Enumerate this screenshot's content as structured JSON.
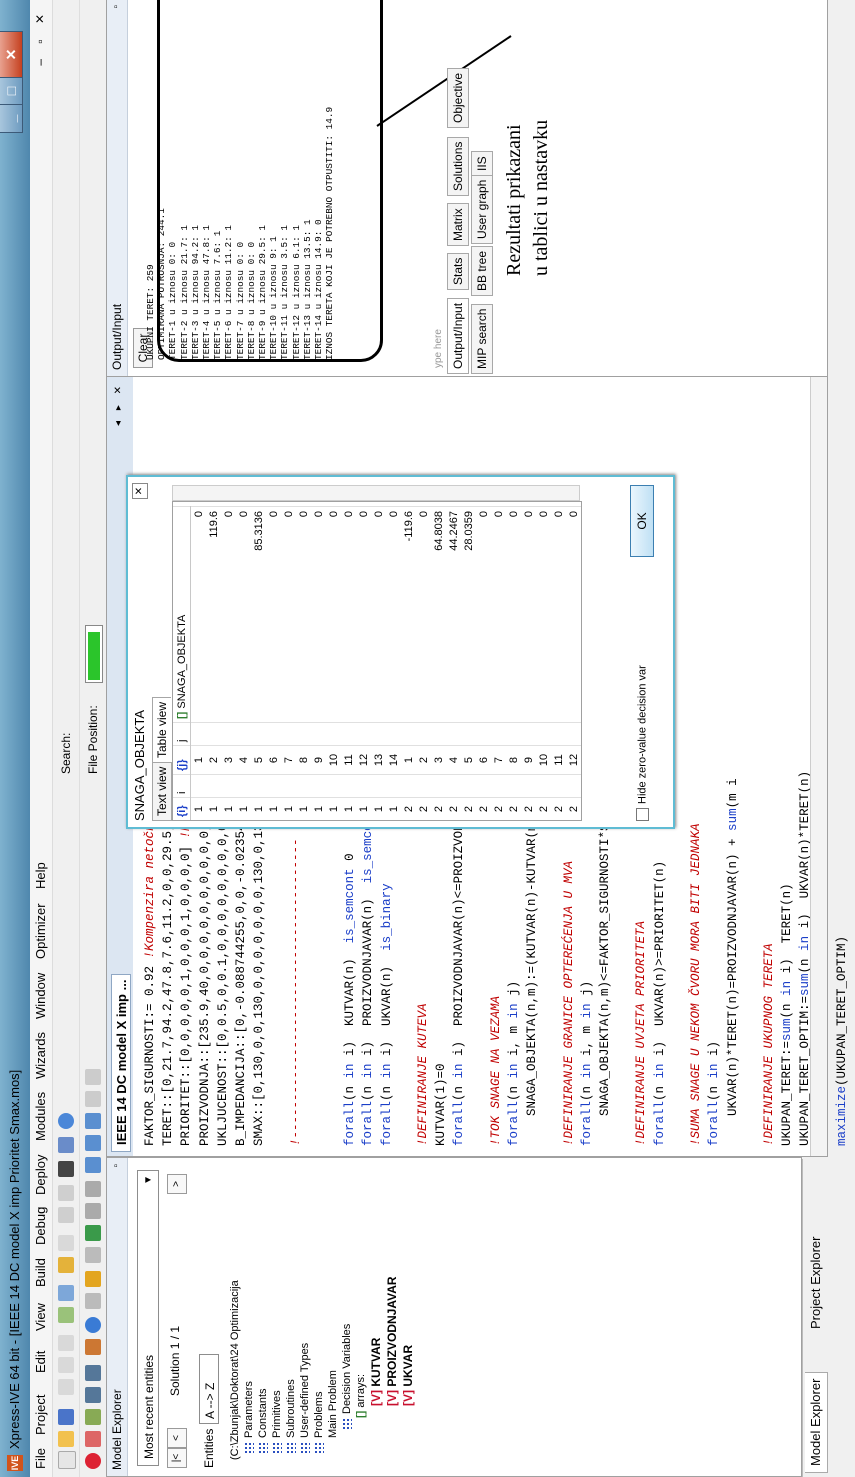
{
  "window": {
    "title": "Xpress-IVE 64 bit - [IEEE 14 DC model X imp Prioritet Smax.mos]",
    "app_icon": "IVE"
  },
  "menu": [
    "File",
    "Project",
    "Edit",
    "View",
    "Build",
    "Debug",
    "Deploy",
    "Modules",
    "Wizards",
    "Window",
    "Optimizer",
    "Help"
  ],
  "toolbar": {
    "search_label": "Search:",
    "file_position_label": "File Position:",
    "file_position_level": 0.92
  },
  "model_explorer": {
    "title": "Model Explorer",
    "recent": "Most recent entities",
    "solution": "Solution 1 / 1",
    "entities_label": "Entities",
    "sort": "A --> Z",
    "tree": {
      "path": "(C:\\Zbunjak\\Doktorat\\24 Optimizacija",
      "parameters": "Parameters",
      "constants": "Constants",
      "primitives": "Primitives",
      "subroutines": "Subroutines",
      "user_types": "User-defined Types",
      "problems": "Problems",
      "main_problem": "Main Problem",
      "decision_vars": "Decision Variables",
      "arrays": "arrays:",
      "vars": [
        "KUTVAR",
        "PROIZVODNJAVAR",
        "UKVAR"
      ]
    },
    "tabs": [
      "Model Explorer",
      "Project Explorer"
    ]
  },
  "editor": {
    "tab": "IEEE 14 DC model X imp ...",
    "lines": [
      [
        "FAKTOR_SIGURNOSTI:= 0.92 ",
        "!Kompenzira netočnost DC"
      ],
      [
        "TERET::[0,21.7,94.2,47.8,7.6,11.2,0,0,29.5,9,3.5,",
        ""
      ],
      [
        "PRIORITET::[0,0,0,0,0,1,0,0,0,1,0,0,0,0] ",
        "!MW"
      ],
      [
        "PROIZVODNJA::[235.9,40,0,0,0,0,0,0,0,0,0,0,0,0]",
        ""
      ],
      [
        "UKLJUCENOST::[0,0.5,0,0.1,0,0,0,0,0,0,0,0,0.5,0",
        ""
      ],
      [
        "B_IMPEDANCIJA::[0,-0.088744255,0,0,-0.023542851,0",
        ""
      ],
      [
        "SMAX::[0,130,0,0,130,0,0,0,0,0,0,0,130,0,130,",
        ""
      ],
      [
        "",
        ""
      ],
      [
        "",
        "!----------------------------------------"
      ],
      [
        "",
        ""
      ],
      [
        "",
        ""
      ],
      [
        "forall(n in i)  KUTVAR(n)  is_semcont 0",
        ""
      ],
      [
        "forall(n in i)  PROIZVODNJAVAR(n)  is_semcont 0",
        ""
      ],
      [
        "forall(n in i)  UKVAR(n)  is_binary",
        ""
      ],
      [
        "",
        ""
      ],
      [
        "",
        "!DEFINIRANJE KUTEVA"
      ],
      [
        "KUTVAR(1)=0",
        ""
      ],
      [
        "forall(n in i)  PROIZVODNJAVAR(n)<=PROIZVODNJA(n)",
        ""
      ],
      [
        "",
        ""
      ],
      [
        "",
        "!TOK SNAGE NA VEZAMA"
      ],
      [
        "forall(n in i, m in j)",
        ""
      ],
      [
        "    SNAGA_OBJEKTA(n,m):=(KUTVAR(n)-KUTVAR(m))*B_I",
        ""
      ],
      [
        "",
        ""
      ],
      [
        "",
        "!DEFINIRANJE GRANICE OPTEREĆENJA U MVA"
      ],
      [
        "forall(n in i, m in j)",
        ""
      ],
      [
        "    SNAGA_OBJEKTA(n,m)<=FAKTOR_SIGURNOSTI*SMAX(n,",
        ""
      ],
      [
        "",
        ""
      ],
      [
        "",
        "!DEFINIRANJE UVJETA PRIORITETA"
      ],
      [
        "forall(n in i)  UKVAR(n)>=PRIORITET(n)",
        ""
      ],
      [
        "",
        ""
      ],
      [
        "",
        "!SUMA SNAGE U NEKOM ČVORU MORA BITI JEDNAKA"
      ],
      [
        "forall(n in i)",
        ""
      ],
      [
        "    UKVAR(n)*TERET(n)=PROIZVODNJAVAR(n) + sum(m i",
        ""
      ],
      [
        "",
        ""
      ],
      [
        "",
        "!DEFINIRANJE UKUPNOG TERETA"
      ],
      [
        "UKUPAN_TERET:=sum(n in i)  TERET(n)",
        ""
      ],
      [
        "UKUPAN_TERET_OPTIM:=sum(n in i)  UKVAR(n)*TERET(n)",
        ""
      ],
      [
        "",
        ""
      ],
      [
        "maximize(UKUPAN_TERET_OPTIM)",
        ""
      ]
    ]
  },
  "popup": {
    "title": "SNAGA_OBJEKTA",
    "tabs": [
      "Text view",
      "Table view"
    ],
    "headers": [
      "i",
      "j",
      "SNAGA_OBJEKTA"
    ],
    "rows": [
      [
        1,
        1,
        "0"
      ],
      [
        1,
        2,
        "119.6"
      ],
      [
        1,
        3,
        "0"
      ],
      [
        1,
        4,
        "0"
      ],
      [
        1,
        5,
        "85.3136"
      ],
      [
        1,
        6,
        "0"
      ],
      [
        1,
        7,
        "0"
      ],
      [
        1,
        8,
        "0"
      ],
      [
        1,
        9,
        "0"
      ],
      [
        1,
        10,
        "0"
      ],
      [
        1,
        11,
        "0"
      ],
      [
        1,
        12,
        "0"
      ],
      [
        1,
        13,
        "0"
      ],
      [
        1,
        14,
        "0"
      ],
      [
        2,
        1,
        "-119.6"
      ],
      [
        2,
        2,
        "0"
      ],
      [
        2,
        3,
        "64.8038"
      ],
      [
        2,
        4,
        "44.2467"
      ],
      [
        2,
        5,
        "28.0359"
      ],
      [
        2,
        6,
        "0"
      ],
      [
        2,
        7,
        "0"
      ],
      [
        2,
        8,
        "0"
      ],
      [
        2,
        9,
        "0"
      ],
      [
        2,
        10,
        "0"
      ],
      [
        2,
        11,
        "0"
      ],
      [
        2,
        12,
        "0"
      ],
      [
        2,
        13,
        "0"
      ],
      [
        2,
        14,
        "0"
      ],
      [
        3,
        1,
        "0"
      ],
      [
        3,
        2,
        "-64.8038"
      ],
      [
        3,
        3,
        "0"
      ],
      [
        3,
        4,
        "-29.3962"
      ]
    ],
    "hide_zero": "Hide zero-value decision var",
    "ok": "OK"
  },
  "output": {
    "title": "Output/Input",
    "clear": "Clear",
    "lines": [
      "UKUPNI TERET: 259",
      "OPTIMIRANA POTROSNJA: 244.1",
      "TERET-1 u iznosu 0: 0",
      "TERET-2 u iznosu 21.7: 1",
      "TERET-3 u iznosu 94.2: 1",
      "TERET-4 u iznosu 47.8: 1",
      "TERET-5 u iznosu 7.6: 1",
      "TERET-6 u iznosu 11.2: 1",
      "TERET-7 u iznosu 0: 0",
      "TERET-8 u iznosu 0: 0",
      "TERET-9 u iznosu 29.5: 1",
      "TERET-10 u iznosu 9: 1",
      "TERET-11 u iznosu 3.5: 1",
      "TERET-12 u iznosu 6.1: 1",
      "TERET-13 u iznosu 13.5: 1",
      "TERET-14 u iznosu 14.9: 0",
      "IZNOS TERETA KOJI JE POTREBNO OTPUSTITI: 14.9"
    ],
    "annotation": "Rezultati prikazani\nu tablici u nastavku",
    "type_here": "ype here",
    "tabs_row1": [
      "Output/Input",
      "Stats",
      "Matrix",
      "Solutions",
      "Objective"
    ],
    "tabs_row2": [
      "MIP search",
      "BB tree",
      "User graph",
      "IIS"
    ]
  }
}
